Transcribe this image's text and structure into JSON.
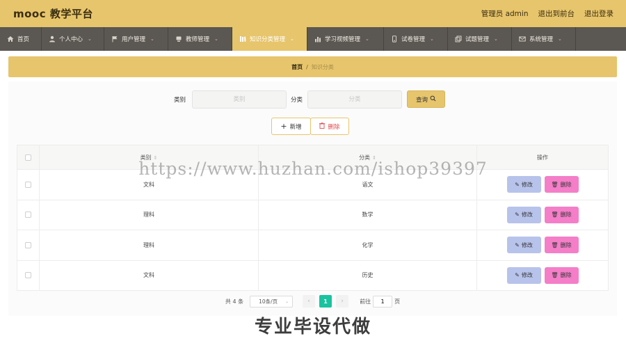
{
  "header": {
    "brand": "mooc 教学平台",
    "admin_label": "管理员 admin",
    "exit_front_label": "退出到前台",
    "logout_label": "退出登录"
  },
  "nav": {
    "items": [
      {
        "label": "首页",
        "icon": "home-icon"
      },
      {
        "label": "个人中心",
        "icon": "user-icon"
      },
      {
        "label": "用户管理",
        "icon": "flag-icon"
      },
      {
        "label": "教师管理",
        "icon": "teacher-icon"
      },
      {
        "label": "知识分类管理",
        "icon": "books-icon"
      },
      {
        "label": "学习视频管理",
        "icon": "bar-chart-icon"
      },
      {
        "label": "试卷管理",
        "icon": "paper-icon"
      },
      {
        "label": "试题管理",
        "icon": "copy-icon"
      },
      {
        "label": "系统管理",
        "icon": "mail-icon"
      }
    ],
    "active_index": 4
  },
  "breadcrumb": {
    "home": "首页",
    "separator": "/",
    "current": "知识分类"
  },
  "search": {
    "type_label": "类别",
    "type_placeholder": "类别",
    "category_label": "分类",
    "category_placeholder": "分类",
    "query_label": "查询"
  },
  "actions": {
    "add_label": "新增",
    "delete_label": "删除"
  },
  "table": {
    "columns": {
      "type": "类别",
      "category": "分类",
      "operations": "操作"
    },
    "edit_label": "修改",
    "delete_label": "删除",
    "rows": [
      {
        "type": "文科",
        "category": "语文"
      },
      {
        "type": "理科",
        "category": "数学"
      },
      {
        "type": "理科",
        "category": "化学"
      },
      {
        "type": "文科",
        "category": "历史"
      }
    ]
  },
  "pagination": {
    "total": "共 4 条",
    "page_size": "10条/页",
    "current_page": "1",
    "goto_label": "前往",
    "goto_value": "1",
    "page_suffix": "页"
  },
  "overlay": {
    "watermark": "https://www.huzhan.com/ishop39397",
    "footer": "专业毕设代做"
  },
  "colors": {
    "primary": "#e7c56c",
    "nav_bg": "#5b5752",
    "edit_button": "#b8c3eb",
    "delete_button": "#f47ec8",
    "page_active": "#19c3a0"
  }
}
